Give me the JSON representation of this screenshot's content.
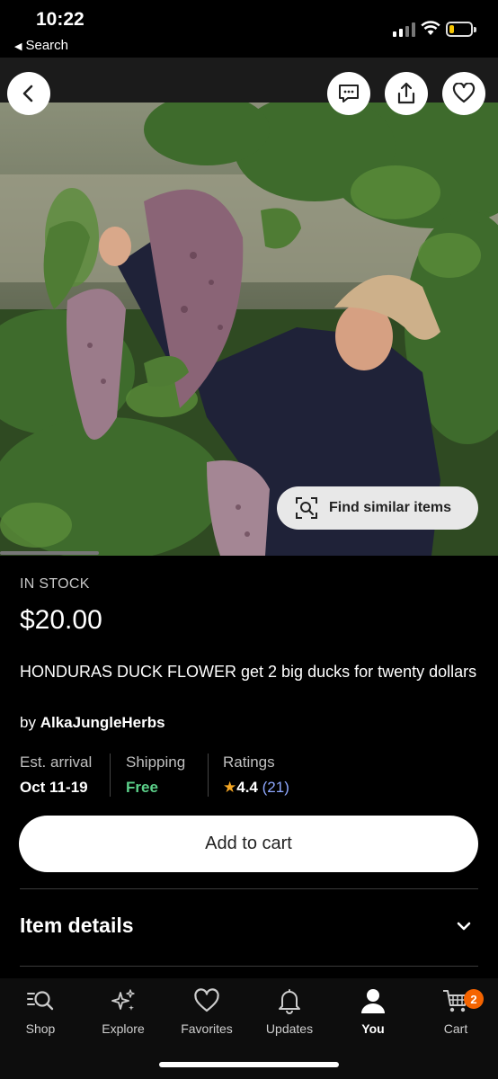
{
  "status_bar": {
    "time": "10:22",
    "back_app": "Search"
  },
  "product": {
    "availability": "IN STOCK",
    "price": "$20.00",
    "title": "HONDURAS DUCK FLOWER get 2 big ducks for twenty dollars",
    "by_prefix": "by",
    "shop_name": "AlkaJungleHerbs"
  },
  "photo": {
    "find_similar_label": "Find similar items"
  },
  "meta": {
    "arrival_label": "Est. arrival",
    "arrival_value": "Oct 11-19",
    "shipping_label": "Shipping",
    "shipping_value": "Free",
    "ratings_label": "Ratings",
    "rating_value": "4.4",
    "rating_count": "(21)"
  },
  "actions": {
    "add_to_cart": "Add to cart"
  },
  "sections": {
    "item_details": "Item details"
  },
  "tabs": [
    {
      "label": "Shop",
      "icon": "shop-search-icon"
    },
    {
      "label": "Explore",
      "icon": "sparkle-icon"
    },
    {
      "label": "Favorites",
      "icon": "heart-icon"
    },
    {
      "label": "Updates",
      "icon": "bell-icon"
    },
    {
      "label": "You",
      "icon": "person-icon",
      "active": true
    },
    {
      "label": "Cart",
      "icon": "cart-icon",
      "badge": "2"
    }
  ],
  "colors": {
    "accent": "#f56400",
    "free": "#5cd08a",
    "star": "#f4a623",
    "rating_count": "#8fa8ff"
  }
}
